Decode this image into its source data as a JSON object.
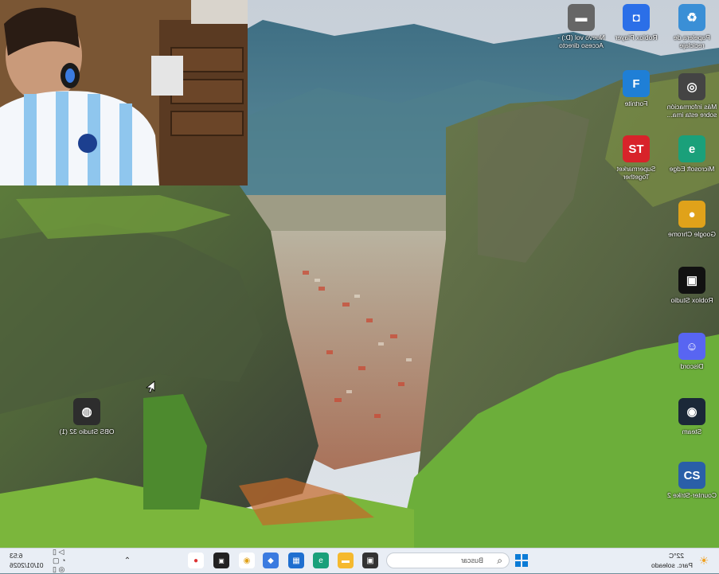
{
  "desktop": {
    "icons": [
      {
        "id": "recycle-bin",
        "label": "Papelera de reciclaje",
        "glyph": "♻",
        "color": "#3a8fd6"
      },
      {
        "id": "roblox-player",
        "label": "Roblox Player",
        "glyph": "◘",
        "color": "#2b6fe8"
      },
      {
        "id": "new-shortcut",
        "label": "Nuevo vol (D:) - Acceso directo",
        "glyph": "▬",
        "color": "#666666"
      },
      {
        "id": "spotlight-info",
        "label": "Más información sobre esta ima...",
        "glyph": "◎",
        "color": "#444444"
      },
      {
        "id": "fortnite",
        "label": "Fortnite",
        "glyph": "F",
        "color": "#1f7fd6"
      },
      {
        "id": "edge",
        "label": "Microsoft Edge",
        "glyph": "e",
        "color": "#1aa07a"
      },
      {
        "id": "supermarket",
        "label": "Supermarket Together",
        "glyph": "ST",
        "color": "#d8232a"
      },
      {
        "id": "chrome",
        "label": "Google Chrome",
        "glyph": "●",
        "color": "#e0a21a"
      },
      {
        "id": "roblox-studio",
        "label": "Roblox Studio",
        "glyph": "▣",
        "color": "#111111"
      },
      {
        "id": "discord",
        "label": "Discord",
        "glyph": "☺",
        "color": "#5865f2"
      },
      {
        "id": "steam",
        "label": "Steam",
        "glyph": "◉",
        "color": "#1b2838"
      },
      {
        "id": "counter-strike",
        "label": "Counter-Strike 2",
        "glyph": "CS",
        "color": "#2a5fa8"
      },
      {
        "id": "obs",
        "label": "OBS Studio 32 (1)",
        "glyph": "◍",
        "color": "#2d2d2d"
      }
    ]
  },
  "taskbar": {
    "weather_temp": "22°C",
    "weather_desc": "Parc. soleado",
    "search_placeholder": "Buscar",
    "clock_time": "6:53",
    "clock_date": "01/01/2026",
    "accent_color": "#0b7bd6"
  }
}
